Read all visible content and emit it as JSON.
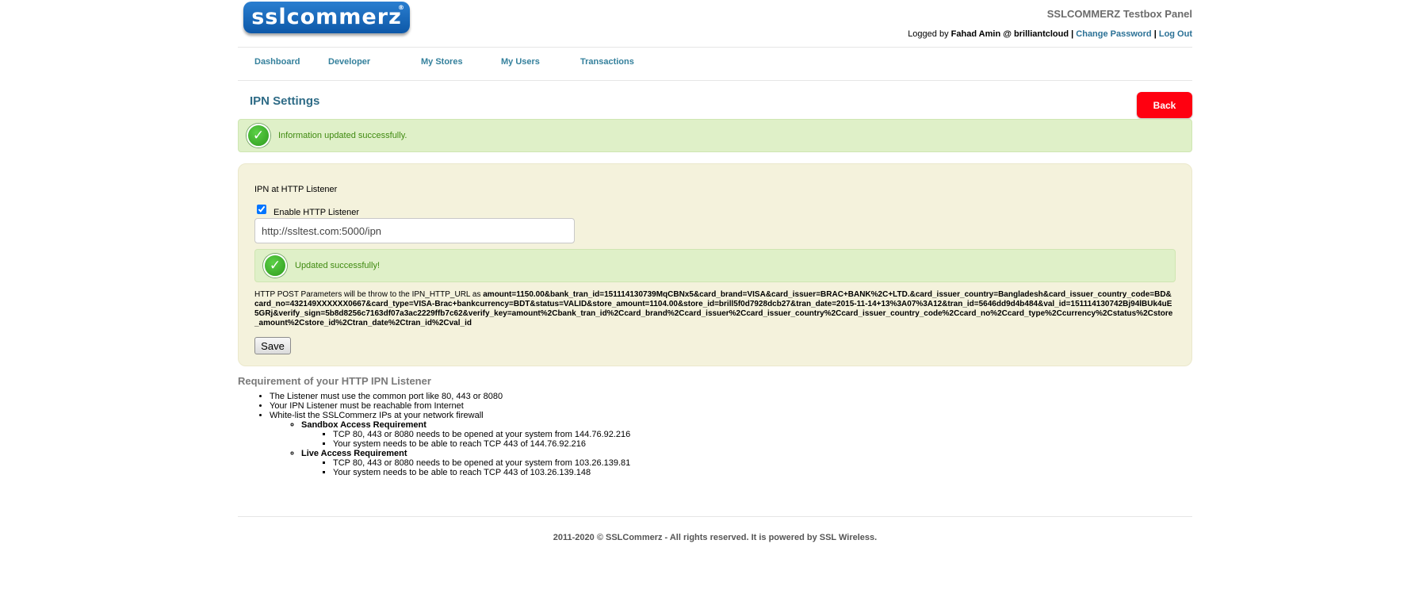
{
  "header": {
    "logo_text": "sslcommerz",
    "logo_reg": "®",
    "panel_title": "SSLCOMMERZ Testbox Panel",
    "logged_by_label": "Logged by",
    "user": "Fahad Amin @ brilliantcloud",
    "separator": "|",
    "change_password": "Change Password",
    "log_out": "Log Out"
  },
  "nav": {
    "items": [
      {
        "label": "Dashboard"
      },
      {
        "label": "Developer"
      },
      {
        "label": "My Stores"
      },
      {
        "label": "My Users"
      },
      {
        "label": "Transactions"
      }
    ]
  },
  "page": {
    "title": "IPN Settings",
    "back_label": "Back",
    "success_message": "Information updated successfully."
  },
  "form": {
    "legend": "IPN at HTTP Listener",
    "enable_label": "Enable HTTP Listener",
    "enable_checked": true,
    "url_value": "http://ssltest.com:5000/ipn",
    "inner_success": "Updated successfully!",
    "params_prefix": "HTTP POST Parameters will be throw to the IPN_HTTP_URL as",
    "params_value": "amount=1150.00&bank_tran_id=151114130739MqCBNx5&card_brand=VISA&card_issuer=BRAC+BANK%2C+LTD.&card_issuer_country=Bangladesh&card_issuer_country_code=BD&card_no=432149XXXXXX0667&card_type=VISA-Brac+bankcurrency=BDT&status=VALID&store_amount=1104.00&store_id=brill5f0d7928dcb27&tran_date=2015-11-14+13%3A07%3A12&tran_id=5646dd9d4b484&val_id=151114130742Bj94lBUk4uE5GRj&verify_sign=5b8d8256c7163df07a3ac2229ffb7c62&verify_key=amount%2Cbank_tran_id%2Ccard_brand%2Ccard_issuer%2Ccard_issuer_country%2Ccard_issuer_country_code%2Ccard_no%2Ccard_type%2Ccurrency%2Cstatus%2Cstore_amount%2Cstore_id%2Ctran_date%2Ctran_id%2Cval_id",
    "save_label": "Save"
  },
  "requirements": {
    "title": "Requirement of your HTTP IPN Listener",
    "items": [
      "The Listener must use the common port like 80, 443 or 8080",
      "Your IPN Listener must be reachable from Internet",
      "White-list the SSLCommerz IPs at your network firewall"
    ],
    "sandbox": {
      "title": "Sandbox Access Requirement",
      "items": [
        "TCP 80, 443 or 8080 needs to be opened at your system from 144.76.92.216",
        "Your system needs to be able to reach TCP 443 of 144.76.92.216"
      ]
    },
    "live": {
      "title": "Live Access Requirement",
      "items": [
        "TCP 80, 443 or 8080 needs to be opened at your system from 103.26.139.81",
        "Your system needs to be able to reach TCP 443 of 103.26.139.148"
      ]
    }
  },
  "footer": {
    "text": "2011-2020 © SSLCommerz - All rights reserved. It is powered by SSL Wireless."
  },
  "colors": {
    "link": "#34809c",
    "title": "#2e6b86",
    "back_button": "#ff0010",
    "success_bg": "#dff0c8",
    "form_bg": "#f4f2dc"
  },
  "icons": {
    "success": "check-circle-icon"
  }
}
